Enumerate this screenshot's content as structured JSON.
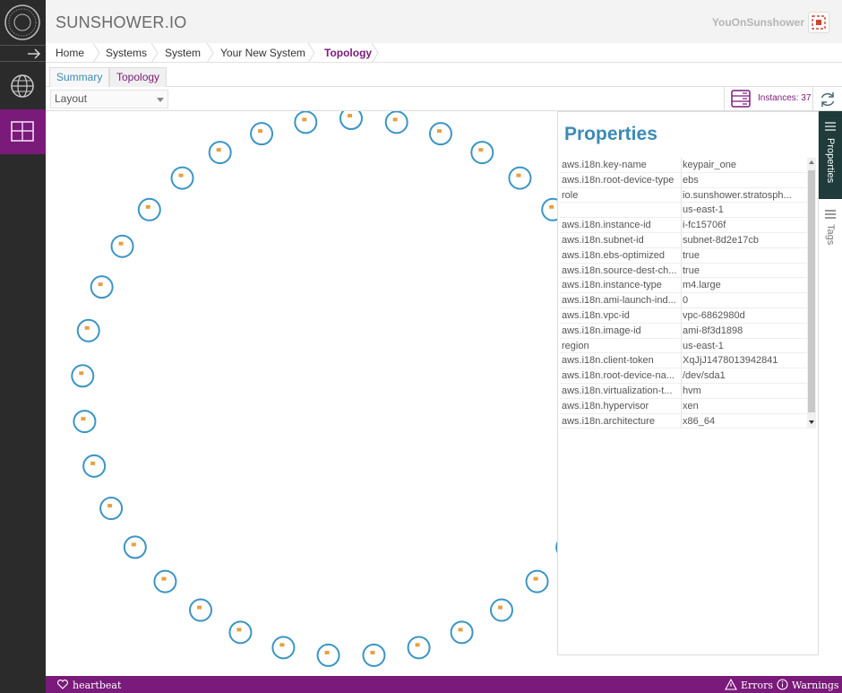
{
  "app": {
    "brand": "SUNSHOWER.IO",
    "user": "YouOnSunshower"
  },
  "breadcrumb": [
    "Home",
    "Systems",
    "System",
    "Your New System",
    "Topology"
  ],
  "tabs": [
    "Summary",
    "Topology"
  ],
  "toolbar": {
    "layout_value": "Layout",
    "instances_label": "Instances: 37"
  },
  "topology": {
    "node_count": 37,
    "node_color": "#3b95c4"
  },
  "properties": {
    "title": "Properties",
    "rows": [
      {
        "key": "aws.i18n.key-name",
        "value": "keypair_one"
      },
      {
        "key": "aws.i18n.root-device-type",
        "value": "ebs"
      },
      {
        "key": "role",
        "value": "io.sunshower.stratosph..."
      },
      {
        "key": "",
        "value": "us-east-1"
      },
      {
        "key": "aws.i18n.instance-id",
        "value": "i-fc15706f"
      },
      {
        "key": "aws.i18n.subnet-id",
        "value": "subnet-8d2e17cb"
      },
      {
        "key": "aws.i18n.ebs-optimized",
        "value": "true"
      },
      {
        "key": "aws.i18n.source-dest-ch...",
        "value": "true"
      },
      {
        "key": "aws.i18n.instance-type",
        "value": "m4.large"
      },
      {
        "key": "aws.i18n.ami-launch-ind...",
        "value": "0"
      },
      {
        "key": "aws.i18n.vpc-id",
        "value": "vpc-6862980d"
      },
      {
        "key": "aws.i18n.image-id",
        "value": "ami-8f3d1898"
      },
      {
        "key": "region",
        "value": "us-east-1"
      },
      {
        "key": "aws.i18n.client-token",
        "value": "XqJjJ1478013942841"
      },
      {
        "key": "aws.i18n.root-device-na...",
        "value": "/dev/sda1"
      },
      {
        "key": "aws.i18n.virtualization-t...",
        "value": "hvm"
      },
      {
        "key": "aws.i18n.hypervisor",
        "value": "xen"
      },
      {
        "key": "aws.i18n.architecture",
        "value": "x86_64"
      }
    ]
  },
  "sidetabs": {
    "properties": "Properties",
    "tags": "Tags"
  },
  "footer": {
    "heartbeat": "heartbeat",
    "errors": "Errors",
    "warnings": "Warnings"
  },
  "colors": {
    "accent": "#7a1a7a",
    "link": "#3b8bb5",
    "nav_bg": "#2b2b2b",
    "panel_tab_bg": "#1f3b3b"
  }
}
